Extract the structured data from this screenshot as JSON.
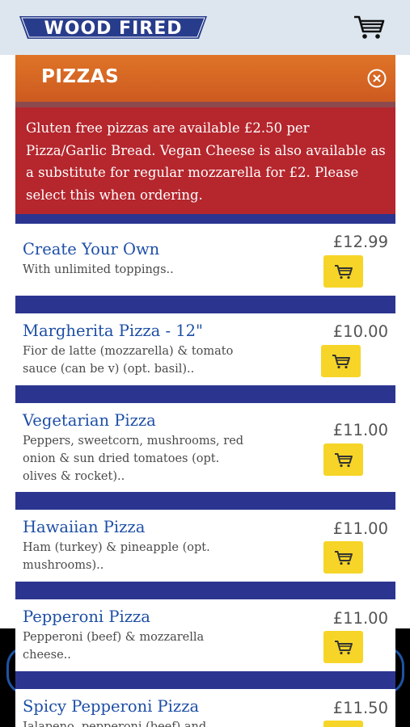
{
  "header": {
    "logo_text": "WOOD FIRED",
    "cart_icon": "shopping-cart-icon"
  },
  "category": {
    "title": "PIZZAS",
    "close_icon": "close-circle-icon"
  },
  "notice": {
    "text": "Gluten free pizzas are available £2.50 per Pizza/Garlic Bread. Vegan Cheese is also available as a substitute for regular mozzarella for £2. Please select this when ordering."
  },
  "items": [
    {
      "name": "Create Your Own",
      "description": "With unlimited toppings..",
      "price": "£12.99"
    },
    {
      "name": "Margherita Pizza - 12\"",
      "description": "Fior de latte (mozzarella) & tomato sauce (can be v) (opt. basil)..",
      "price": "£10.00"
    },
    {
      "name": "Vegetarian Pizza",
      "description": "Peppers, sweetcorn, mushrooms, red onion & sun dried tomatoes (opt. olives & rocket)..",
      "price": "£11.00"
    },
    {
      "name": "Hawaiian Pizza",
      "description": "Ham (turkey) & pineapple (opt. mushrooms)..",
      "price": "£11.00"
    },
    {
      "name": "Pepperoni Pizza",
      "description": "Pepperoni (beef) & mozzarella cheese..",
      "price": "£11.00"
    },
    {
      "name": "Spicy Pepperoni Pizza",
      "description": "Jalapeno, pepperoni (beef) and",
      "price": "£11.50"
    }
  ],
  "colors": {
    "header_bg": "#dde6ee",
    "category_orange": "#d9672a",
    "notice_red": "#b5262d",
    "divider_navy": "#2b3590",
    "item_name_blue": "#1d4ea6",
    "add_button_yellow": "#f6d528"
  }
}
